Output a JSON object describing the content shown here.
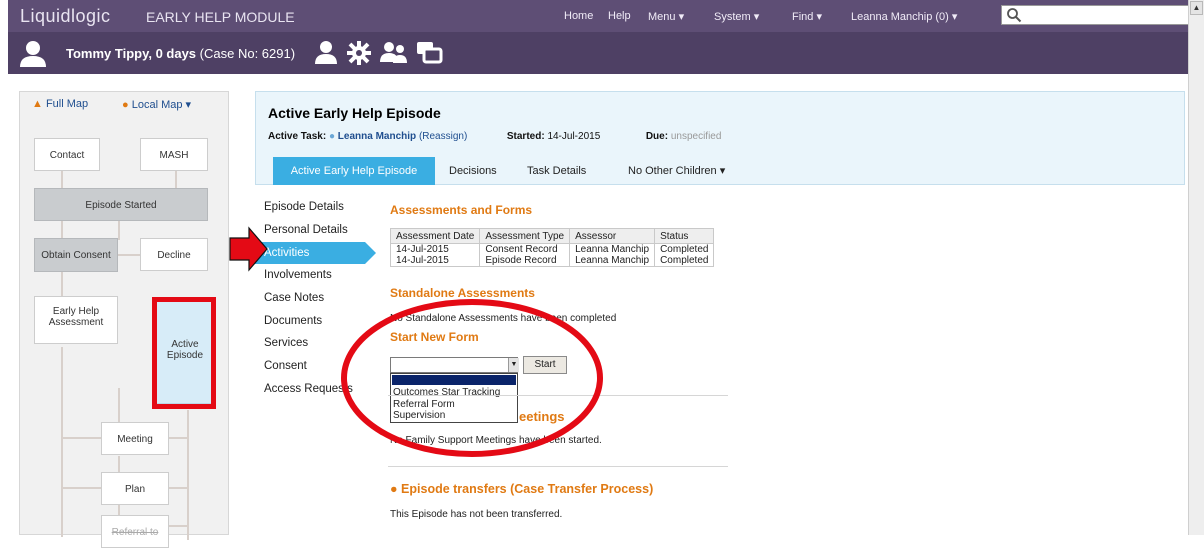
{
  "app": {
    "brand": "Liquidlogic",
    "module": "EARLY HELP MODULE"
  },
  "nav": {
    "home": "Home",
    "help": "Help",
    "menu": "Menu ▾",
    "system": "System ▾",
    "find": "Find ▾",
    "user": "Leanna Manchip (0) ▾",
    "search_value": ""
  },
  "case": {
    "name": "Tommy Tippy, 0 days",
    "case_no": "(Case No: 6291)"
  },
  "map": {
    "full_map": "Full Map",
    "local_map": "Local Map ▾",
    "boxes": {
      "contact": "Contact",
      "mash": "MASH",
      "episode_started": "Episode Started",
      "obtain_consent": "Obtain Consent",
      "hidden_box": "Decline",
      "early_help_assessment": "Early Help Assessment",
      "active_episode": "Active Episode",
      "meeting": "Meeting",
      "plan": "Plan",
      "referral_to": "Referral to"
    }
  },
  "header": {
    "title": "Active Early Help Episode",
    "active_task_label": "Active Task:",
    "active_task_user": "Leanna Manchip",
    "reassign": "(Reassign)",
    "started_label": "Started:",
    "started_value": "14-Jul-2015",
    "due_label": "Due:",
    "due_value": "unspecified",
    "tabs": [
      "Active Early Help Episode",
      "Decisions",
      "Task Details",
      "No Other Children ▾"
    ]
  },
  "side_nav": [
    "Episode Details",
    "Personal Details",
    "Activities",
    "Involvements",
    "Case Notes",
    "Documents",
    "Services",
    "Consent",
    "Access Requests"
  ],
  "assessments": {
    "title": "Assessments and Forms",
    "columns": [
      "Assessment Date",
      "Assessment Type",
      "Assessor",
      "Status"
    ],
    "rows": [
      [
        "14-Jul-2015",
        "Consent Record",
        "Leanna Manchip",
        "Completed"
      ],
      [
        "14-Jul-2015",
        "Episode Record",
        "Leanna Manchip",
        "Completed"
      ]
    ]
  },
  "standalone": {
    "title": "Standalone Assessments",
    "text": "No Standalone Assessments have been completed"
  },
  "start_form": {
    "title": "Start New Form",
    "select_value": "",
    "start_button": "Start",
    "options": [
      "Outcomes Star Tracking",
      "Referral Form",
      "Supervision"
    ]
  },
  "meetings": {
    "title_visible": "eetings",
    "text": "No Family Support Meetings have been started."
  },
  "transfers": {
    "title": "Episode transfers (Case Transfer Process)",
    "text": "This Episode has not been transferred."
  },
  "colors": {
    "topbar": "#5e4e75",
    "subbar": "#4e4064",
    "accent_blue": "#3aaee2",
    "section_orange": "#e07a13",
    "annotation_red": "#e40a15"
  }
}
